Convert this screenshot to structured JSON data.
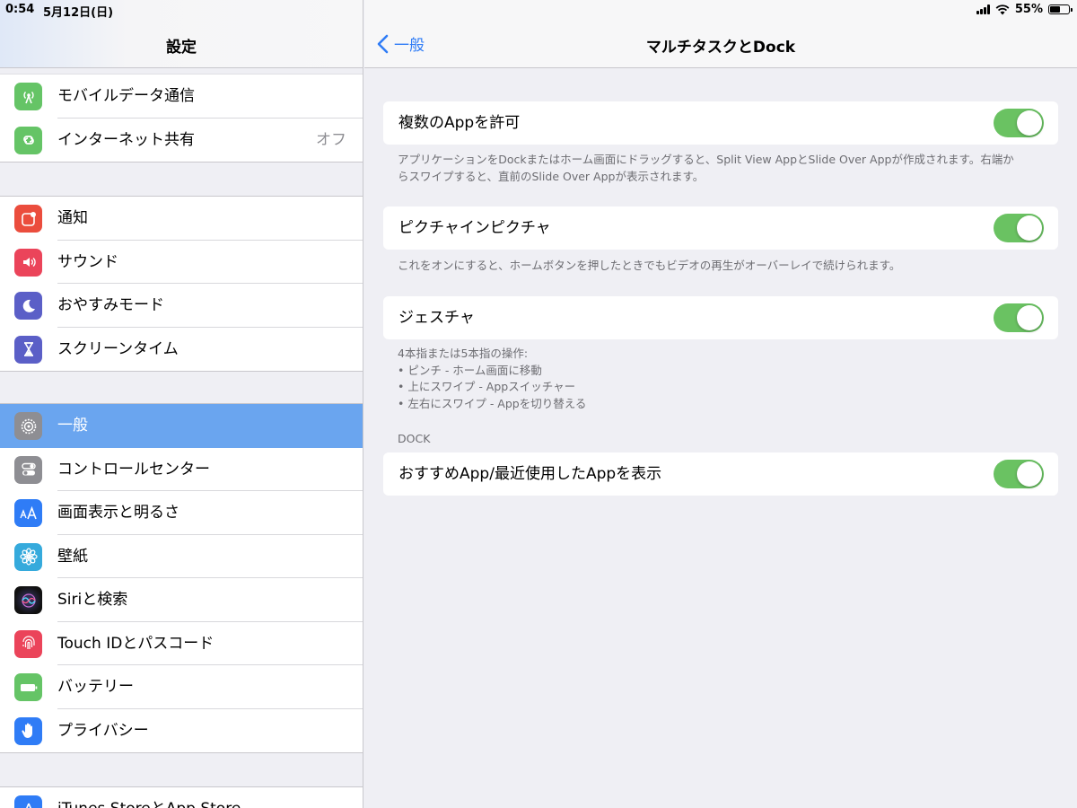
{
  "status_bar": {
    "time": "0:54",
    "date": "5月12日(日)",
    "battery_text": "55%",
    "battery_level": 0.55
  },
  "sidebar": {
    "title": "設定",
    "groups": [
      {
        "items": [
          {
            "label": "モバイルデータ通信",
            "icon": "antenna-icon",
            "color": "#65c466"
          },
          {
            "label": "インターネット共有",
            "icon": "link-icon",
            "color": "#65c466",
            "value": "オフ"
          }
        ]
      },
      {
        "items": [
          {
            "label": "通知",
            "icon": "notification-icon",
            "color": "#eb4d3d"
          },
          {
            "label": "サウンド",
            "icon": "speaker-icon",
            "color": "#eb445a"
          },
          {
            "label": "おやすみモード",
            "icon": "moon-icon",
            "color": "#5b5fc7"
          },
          {
            "label": "スクリーンタイム",
            "icon": "hourglass-icon",
            "color": "#5b5fc7"
          }
        ]
      },
      {
        "items": [
          {
            "label": "一般",
            "icon": "gear-icon",
            "color": "#8e8e93",
            "selected": true
          },
          {
            "label": "コントロールセンター",
            "icon": "toggles-icon",
            "color": "#8e8e93"
          },
          {
            "label": "画面表示と明るさ",
            "icon": "text-size-icon",
            "color": "#2f7cf6"
          },
          {
            "label": "壁紙",
            "icon": "flower-icon",
            "color": "#35aadc"
          },
          {
            "label": "Siriと検索",
            "icon": "siri-icon",
            "color": "#1c1c2e"
          },
          {
            "label": "Touch IDとパスコード",
            "icon": "fingerprint-icon",
            "color": "#eb445a"
          },
          {
            "label": "バッテリー",
            "icon": "battery-icon",
            "color": "#65c466"
          },
          {
            "label": "プライバシー",
            "icon": "hand-icon",
            "color": "#2f7cf6"
          }
        ]
      },
      {
        "items": [
          {
            "label": "iTunes StoreとApp Store",
            "icon": "app-store-icon",
            "color": "#2f7cf6"
          }
        ]
      }
    ]
  },
  "detail": {
    "back_label": "一般",
    "title": "マルチタスクとDock",
    "accent_color": "#2f7cf6",
    "toggle_color": "#6ac262",
    "settings": [
      {
        "label": "複数のAppを許可",
        "on": true,
        "footnote": [
          "アプリケーションをDockまたはホーム画面にドラッグすると、Split View AppとSlide Over Appが作成されます。右端か",
          "らスワイプすると、直前のSlide Over Appが表示されます。"
        ]
      },
      {
        "label": "ピクチャインピクチャ",
        "on": true,
        "footnote": [
          "これをオンにすると、ホームボタンを押したときでもビデオの再生がオーバーレイで続けられます。"
        ]
      },
      {
        "label": "ジェスチャ",
        "on": true,
        "footnote": [
          "4本指または5本指の操作:",
          "• ピンチ - ホーム画面に移動",
          "• 上にスワイプ - Appスイッチャー",
          "• 左右にスワイプ - Appを切り替える"
        ]
      }
    ],
    "dock_section": {
      "header": "DOCK",
      "settings": [
        {
          "label": "おすすめApp/最近使用したAppを表示",
          "on": true
        }
      ]
    }
  }
}
